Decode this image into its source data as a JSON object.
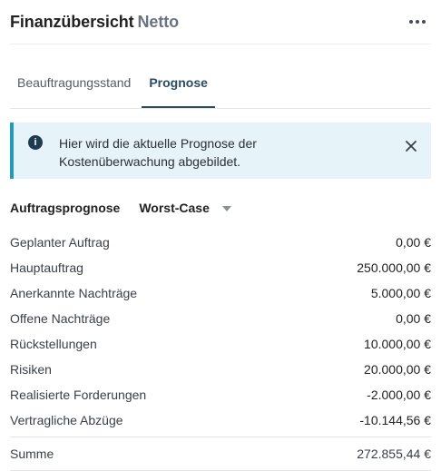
{
  "header": {
    "title": "Finanzübersicht",
    "subtitle": "Netto",
    "more_icon": "more-horizontal-icon"
  },
  "tabs": [
    {
      "label": "Beauftragungsstand",
      "active": false
    },
    {
      "label": "Prognose",
      "active": true
    }
  ],
  "info": {
    "icon": "info-icon",
    "text": "Hier wird die aktuelle Prognose der Kostenüberwachung abgebildet.",
    "close_icon": "close-icon",
    "accent": "#1f9bbf",
    "background": "#e6f3f8"
  },
  "forecast": {
    "label": "Auftragsprognose",
    "selected": "Worst-Case"
  },
  "rows": [
    {
      "label": "Geplanter Auftrag",
      "value": "0,00 €"
    },
    {
      "label": "Hauptauftrag",
      "value": "250.000,00 €"
    },
    {
      "label": "Anerkannte Nachträge",
      "value": "5.000,00 €"
    },
    {
      "label": "Offene Nachträge",
      "value": "0,00 €"
    },
    {
      "label": "Rückstellungen",
      "value": "10.000,00 €"
    },
    {
      "label": "Risiken",
      "value": "20.000,00 €"
    },
    {
      "label": "Realisierte Forderungen",
      "value": "-2.000,00 €"
    },
    {
      "label": "Vertragliche Abzüge",
      "value": "-10.144,56 €"
    }
  ],
  "sum": {
    "label": "Summe",
    "value": "272.855,44 €"
  }
}
